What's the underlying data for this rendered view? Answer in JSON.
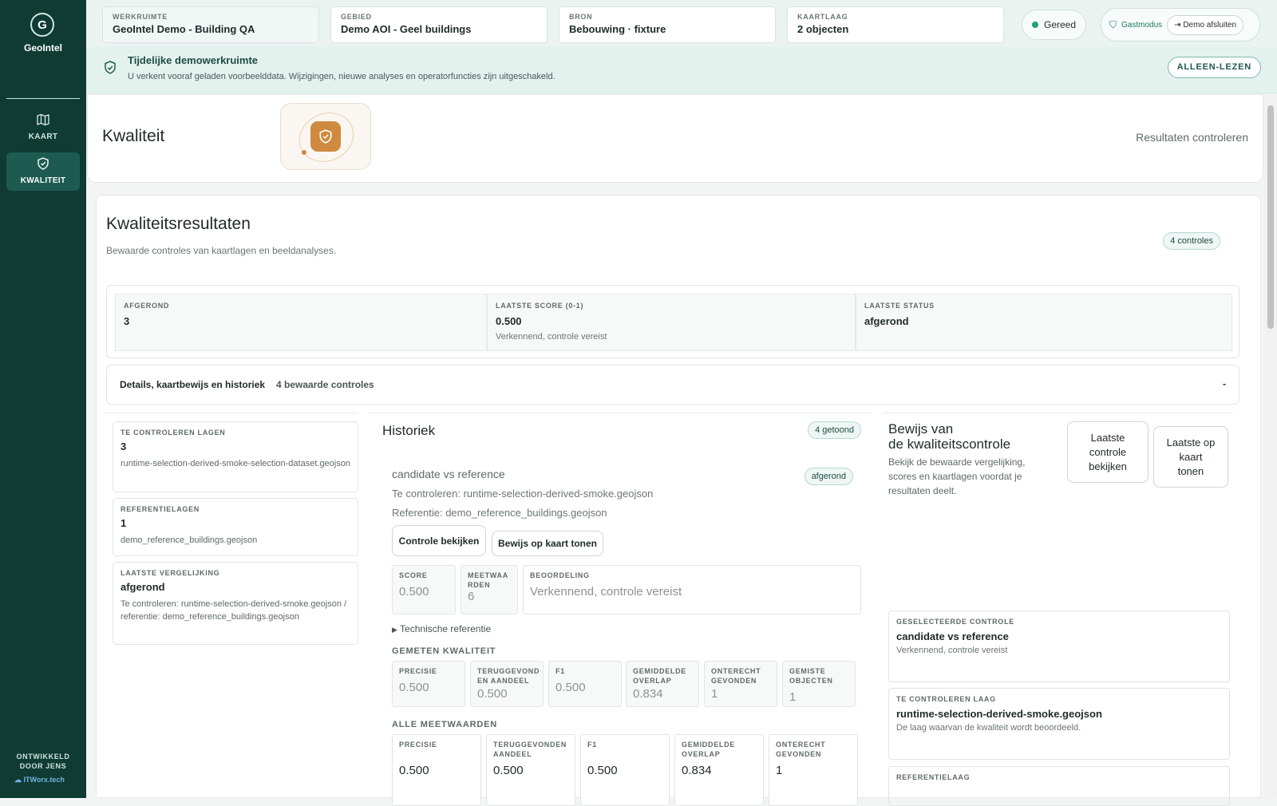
{
  "sidebar": {
    "brand": "GeoIntel",
    "logo_letter": "G",
    "nav": [
      {
        "label": "KAART",
        "icon": "map-icon"
      },
      {
        "label": "KWALITEIT",
        "icon": "shield-check-icon"
      }
    ],
    "footer": "ONTWIKKELD DOOR JENS",
    "footer_logo": "ITWorx.tech"
  },
  "topbar": {
    "cards": [
      {
        "key": "WERKRUIMTE",
        "value": "GeoIntel Demo - Building QA"
      },
      {
        "key": "GEBIED",
        "value": "Demo AOI - Geel buildings"
      },
      {
        "key": "BRON",
        "value": "Bebouwing · fixture"
      },
      {
        "key": "KAARTLAAG",
        "value": "2 objecten"
      }
    ],
    "status": "Gereed",
    "guest": "Gastmodus",
    "exit": "Demo afsluiten"
  },
  "banner": {
    "title": "Tijdelijke demowerkruimte",
    "text": "U verkent vooraf geladen voorbeelddata. Wijzigingen, nieuwe analyses en operatorfuncties zijn uitgeschakeld.",
    "badge": "ALLEEN-LEZEN"
  },
  "hero": {
    "title": "Kwaliteit",
    "link": "Resultaten controleren"
  },
  "main": {
    "title": "Kwaliteitsresultaten",
    "subtitle": "Bewaarde controles van kaartlagen en beeldanalyses.",
    "count": "4 controles",
    "stats": [
      {
        "key": "AFGEROND",
        "value": "3",
        "sub": ""
      },
      {
        "key": "LAATSTE SCORE (0-1)",
        "value": "0.500",
        "sub": "Verkennend, controle vereist"
      },
      {
        "key": "LAATSTE STATUS",
        "value": "afgerond",
        "sub": ""
      }
    ],
    "details": {
      "label": "Details, kaartbewijs en historiek",
      "count": "4 bewaarde controles",
      "toggle": "-"
    }
  },
  "layers": [
    {
      "key": "TE CONTROLEREN LAGEN",
      "value": "3",
      "sub": "runtime-selection-derived-smoke-selection-dataset.geojson"
    },
    {
      "key": "REFERENTIELAGEN",
      "value": "1",
      "sub": "demo_reference_buildings.geojson"
    },
    {
      "key": "LAATSTE VERGELIJKING",
      "value": "afgerond",
      "sub": "Te controleren: runtime-selection-derived-smoke.geojson / referentie: demo_reference_buildings.geojson"
    }
  ],
  "history": {
    "title": "Historiek",
    "shown": "4 getoond",
    "item": {
      "title": "candidate vs reference",
      "status": "afgerond",
      "candidate": "Te controleren: runtime-selection-derived-smoke.geojson",
      "reference": "Referentie: demo_reference_buildings.geojson",
      "btn_view": "Controle bekijken",
      "btn_map": "Bewijs op kaart tonen",
      "score_key": "SCORE",
      "score": "0.500",
      "measure_key": "MEETWAA RDEN",
      "measure": "6",
      "judge_key": "BEOORDELING",
      "judge": "Verkennend, controle vereist",
      "tech": "Technische referentie",
      "measured_title": "GEMETEN KWALITEIT",
      "measured": [
        {
          "k": "PRECISIE",
          "v": "0.500"
        },
        {
          "k": "TERUGGEVOND EN AANDEEL",
          "v": "0.500"
        },
        {
          "k": "F1",
          "v": "0.500"
        },
        {
          "k": "GEMIDDELDE OVERLAP",
          "v": "0.834"
        },
        {
          "k": "ONTERECHT GEVONDEN",
          "v": "1"
        },
        {
          "k": "GEMISTE OBJECTEN",
          "v": "1"
        }
      ],
      "all_title": "ALLE MEETWAARDEN",
      "all": [
        {
          "k": "PRECISIE",
          "v": "0.500"
        },
        {
          "k": "TERUGGEVONDEN AANDEEL",
          "v": "0.500"
        },
        {
          "k": "F1",
          "v": "0.500"
        },
        {
          "k": "GEMIDDELDE OVERLAP",
          "v": "0.834"
        },
        {
          "k": "ONTERECHT GEVONDEN",
          "v": "1"
        }
      ]
    }
  },
  "evidence": {
    "title1": "Bewijs van",
    "title2": "de kwaliteitscontrole",
    "text": "Bekijk de bewaarde vergelijking, scores en kaartlagen voordat je resultaten deelt.",
    "btn1": "Laatste controle bekijken",
    "btn2": "Laatste op kaart tonen",
    "cards": [
      {
        "key": "GESELECTEERDE CONTROLE",
        "value": "candidate vs reference",
        "sub": "Verkennend, controle vereist"
      },
      {
        "key": "TE CONTROLEREN LAAG",
        "value": "runtime-selection-derived-smoke.geojson",
        "sub": "De laag waarvan de kwaliteit wordt beoordeeld."
      },
      {
        "key": "REFERENTIELAAG",
        "value": "",
        "sub": ""
      }
    ]
  }
}
